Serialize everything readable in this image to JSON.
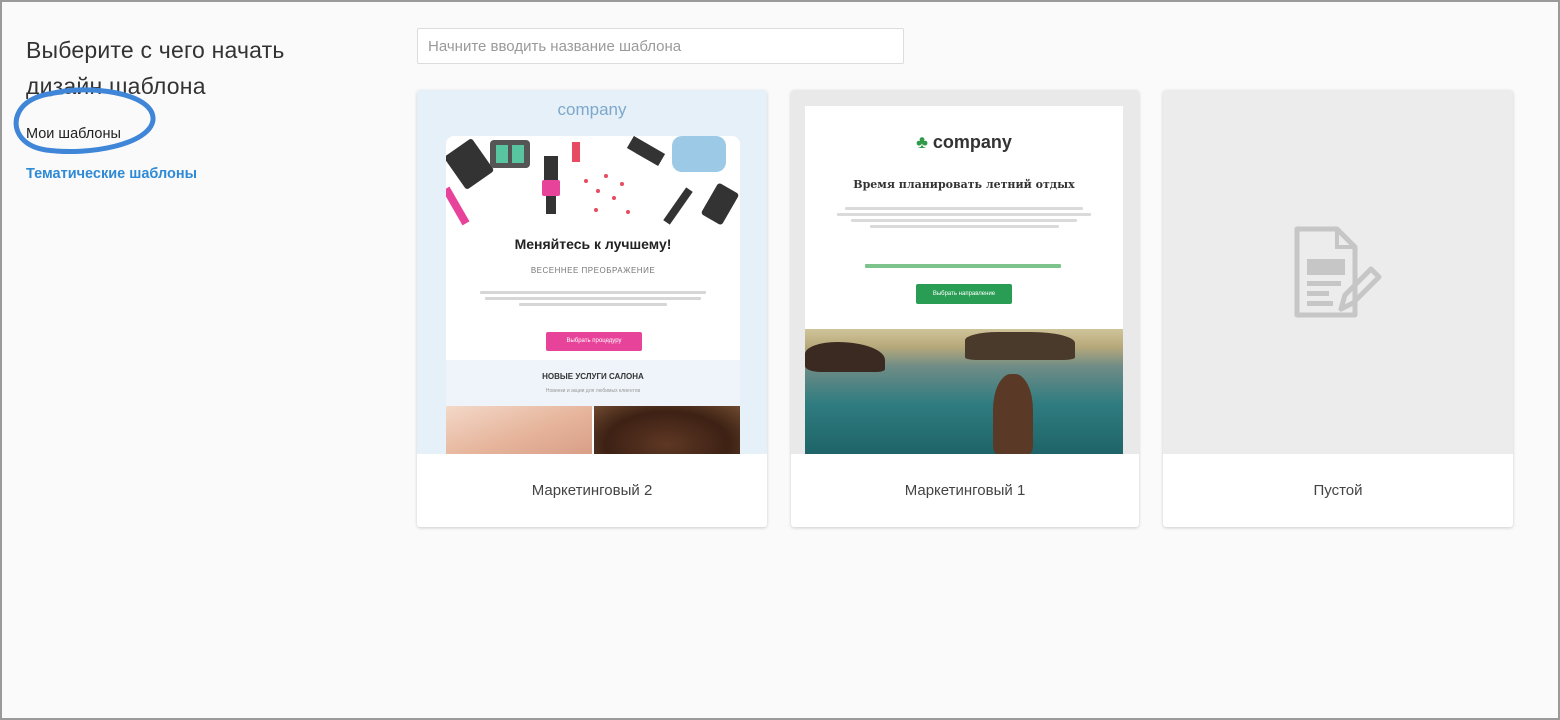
{
  "sidebar": {
    "title": "Выберите с чего начать дизайн шаблона",
    "nav": {
      "my_templates": "Мои шаблоны",
      "thematic_templates": "Тематические шаблоны"
    }
  },
  "search": {
    "placeholder": "Начните вводить название шаблона",
    "value": ""
  },
  "cards": [
    {
      "label": "Маркетинговый 2",
      "preview": {
        "logo": "company",
        "headline": "Меняйтесь к лучшему!",
        "subheadline": "ВЕСЕННЕЕ ПРЕОБРАЖЕНИЕ",
        "button": "Выбрать процедуру",
        "section_title": "НОВЫЕ УСЛУГИ САЛОНА",
        "section_sub": "Новинки и акции для любимых клиентов"
      }
    },
    {
      "label": "Маркетинговый 1",
      "preview": {
        "logo": "company",
        "headline": "Время планировать летний отдых",
        "button": "Выбрать направление"
      }
    },
    {
      "label": "Пустой",
      "preview": {
        "icon": "blank-document-edit-icon"
      }
    }
  ],
  "colors": {
    "accent_link": "#2f8ad6",
    "annotation_circle": "#3f86d8",
    "pink_button": "#e8439a",
    "green_button": "#2a9d54"
  }
}
